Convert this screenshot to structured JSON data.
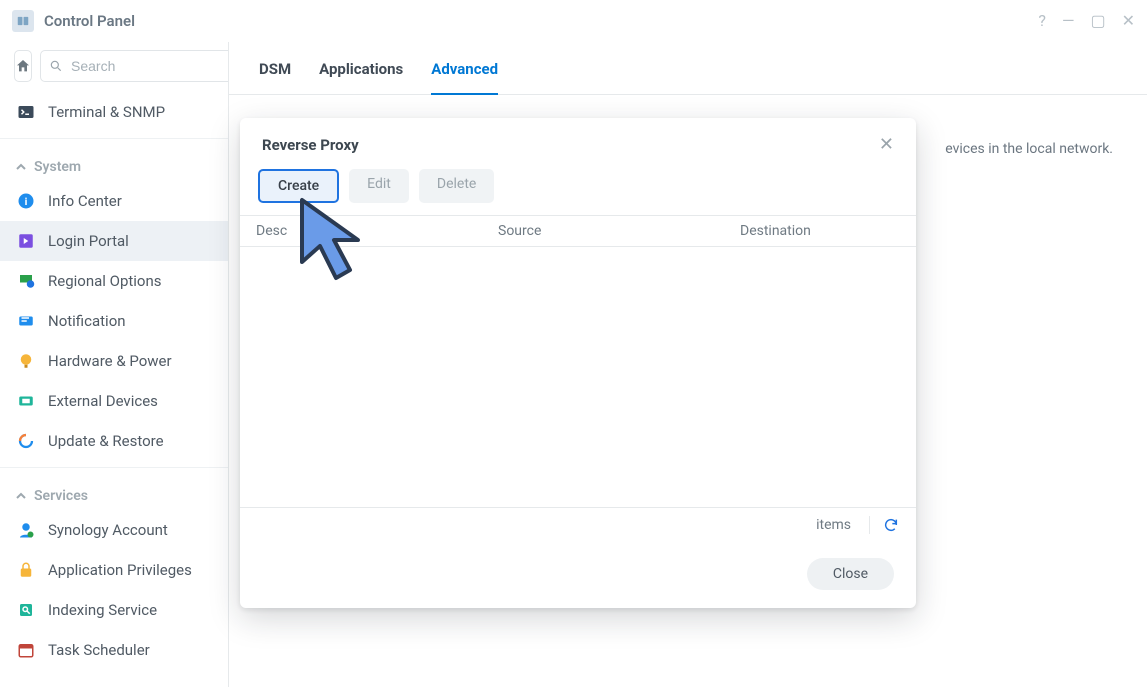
{
  "window": {
    "title": "Control Panel"
  },
  "search": {
    "placeholder": "Search"
  },
  "sidebar": {
    "topItem": {
      "label": "Terminal & SNMP"
    },
    "groups": [
      {
        "label": "System",
        "items": [
          {
            "label": "Info Center"
          },
          {
            "label": "Login Portal"
          },
          {
            "label": "Regional Options"
          },
          {
            "label": "Notification"
          },
          {
            "label": "Hardware & Power"
          },
          {
            "label": "External Devices"
          },
          {
            "label": "Update & Restore"
          }
        ]
      },
      {
        "label": "Services",
        "items": [
          {
            "label": "Synology Account"
          },
          {
            "label": "Application Privileges"
          },
          {
            "label": "Indexing Service"
          },
          {
            "label": "Task Scheduler"
          }
        ]
      }
    ]
  },
  "tabs": {
    "items": [
      {
        "label": "DSM"
      },
      {
        "label": "Applications"
      },
      {
        "label": "Advanced"
      }
    ],
    "activeIndex": 2
  },
  "page": {
    "sectionTitle": "Reverse Proxy",
    "descriptionTail": "evices in the local network."
  },
  "modal": {
    "title": "Reverse Proxy",
    "buttons": {
      "create": "Create",
      "edit": "Edit",
      "delete": "Delete"
    },
    "columns": {
      "description": "Desc",
      "source": "Source",
      "destination": "Destination"
    },
    "footer": {
      "itemsLabel": "items"
    },
    "closeLabel": "Close"
  }
}
